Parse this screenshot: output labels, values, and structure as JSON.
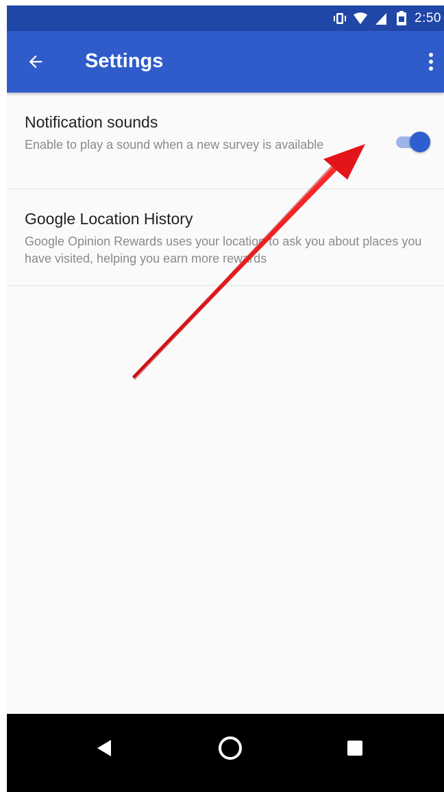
{
  "status_bar": {
    "time": "2:50",
    "icons": [
      "vibrate-icon",
      "wifi-icon",
      "cell-signal-icon",
      "battery-icon"
    ]
  },
  "app_bar": {
    "title": "Settings",
    "icons": [
      "arrow-back-icon",
      "more-vert-icon"
    ]
  },
  "settings": [
    {
      "title": "Notification sounds",
      "summary": "Enable to play a sound when a new survey is available",
      "toggle_on": true
    },
    {
      "title": "Google Location History",
      "summary": "Google Opinion Rewards uses your location to ask you about places you have visited, helping you earn more rewards"
    }
  ],
  "nav_bar": {
    "icons": [
      "nav-back-icon",
      "nav-home-icon",
      "nav-recents-icon"
    ]
  },
  "colors": {
    "status_bar": "#2046a8",
    "app_bar": "#2f5cca",
    "accent": "#2e5fd0",
    "annotation_arrow": "#e3151a"
  }
}
